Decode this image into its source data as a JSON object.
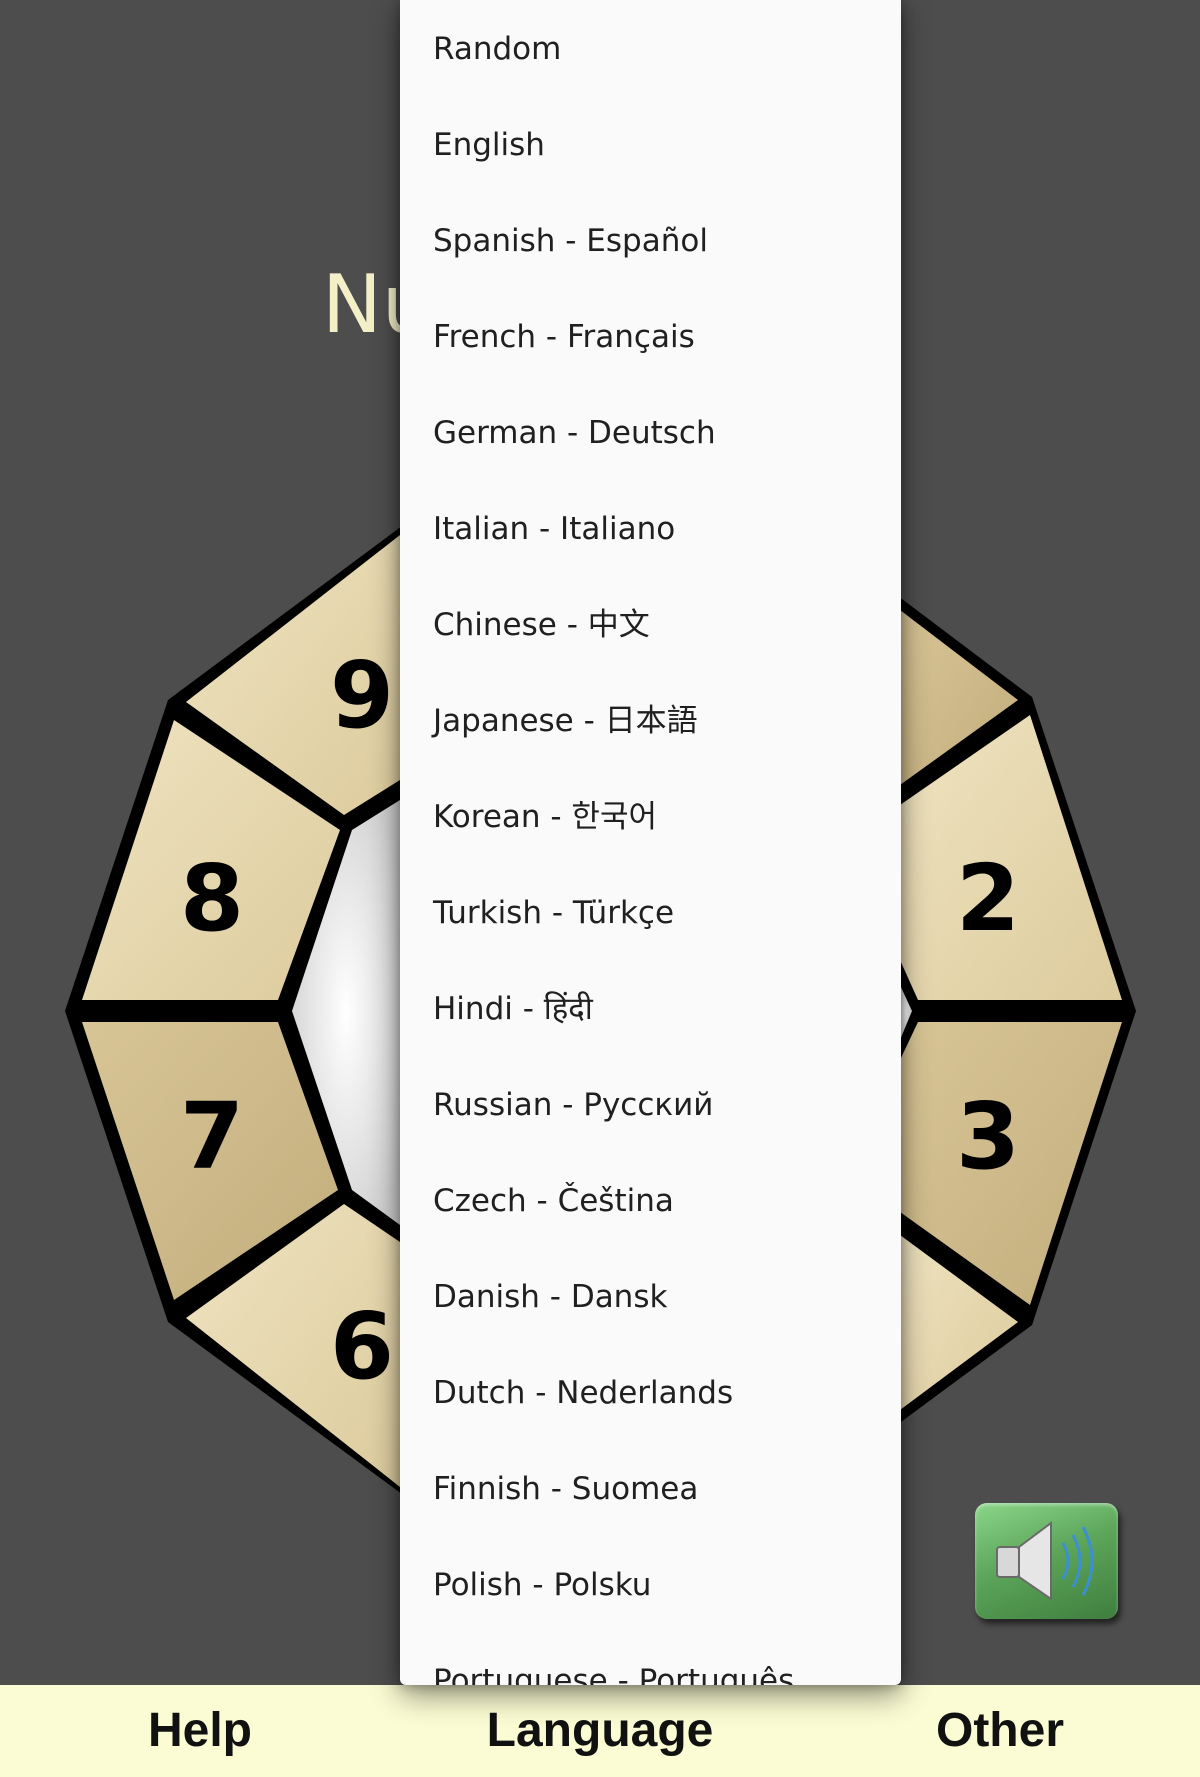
{
  "app": {
    "title_visible": "Nu"
  },
  "wheel": {
    "digits": {
      "two": "2",
      "three": "3",
      "six": "6",
      "seven": "7",
      "eight": "8",
      "nine": "9"
    },
    "colors": {
      "segment_light": "#e8dab4",
      "segment_dark": "#c9b485",
      "outline": "#000000",
      "center": "#e0e0e0"
    }
  },
  "language_menu": {
    "items": [
      "Random",
      "English",
      "Spanish - Español",
      "French - Français",
      "German - Deutsch",
      "Italian - Italiano",
      "Chinese - 中文",
      "Japanese - 日本語",
      "Korean - 한국어",
      "Turkish - Türkçe",
      "Hindi - हिंदी",
      "Russian - Русский",
      "Czech - Čeština",
      "Danish - Dansk",
      "Dutch - Nederlands",
      "Finnish - Suomea",
      "Polish - Polsku",
      "Portuguese - Português"
    ]
  },
  "sound_button": {
    "icon": "speaker-icon",
    "color": "#5da65b"
  },
  "bottom_bar": {
    "help_label": "Help",
    "language_label": "Language",
    "other_label": "Other",
    "background": "#fbfcd3"
  }
}
